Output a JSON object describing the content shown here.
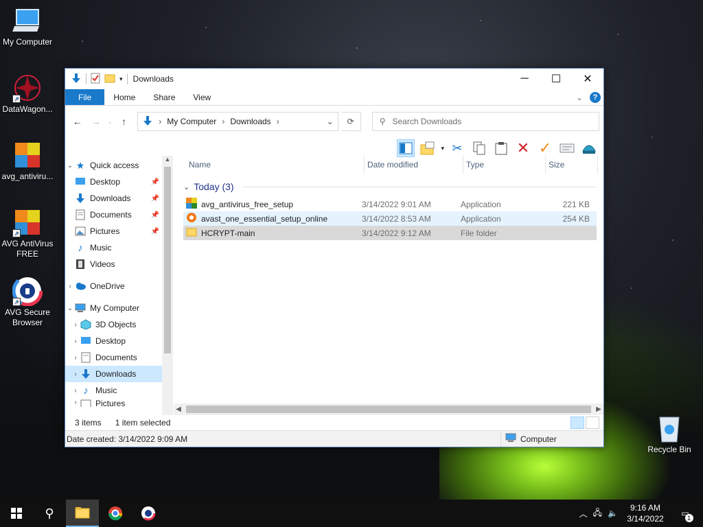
{
  "desktop": {
    "icons": [
      {
        "label": "My Computer",
        "icon": "computer-icon"
      },
      {
        "label": "DataWagon...",
        "icon": "datawagon-icon"
      },
      {
        "label": "avg_antiviru...",
        "icon": "avg-installer-icon"
      },
      {
        "label": "AVG AntiVirus FREE",
        "icon": "avg-antivirus-icon"
      },
      {
        "label": "AVG Secure Browser",
        "icon": "avg-browser-icon"
      },
      {
        "label": "Recycle Bin",
        "icon": "recycle-bin-icon"
      }
    ]
  },
  "window": {
    "title": "Downloads",
    "tabs": [
      "File",
      "Home",
      "Share",
      "View"
    ],
    "breadcrumb": [
      "My Computer",
      "Downloads"
    ],
    "search_placeholder": "Search Downloads",
    "columns": [
      "Name",
      "Date modified",
      "Type",
      "Size"
    ],
    "group_label": "Today (3)",
    "files": [
      {
        "name": "avg_antivirus_free_setup",
        "date": "3/14/2022 9:01 AM",
        "type": "Application",
        "size": "221 KB",
        "icon": "avg-setup-icon"
      },
      {
        "name": "avast_one_essential_setup_online",
        "date": "3/14/2022 8:53 AM",
        "type": "Application",
        "size": "254 KB",
        "icon": "avast-setup-icon"
      },
      {
        "name": "HCRYPT-main",
        "date": "3/14/2022 9:12 AM",
        "type": "File folder",
        "size": "",
        "icon": "folder-icon"
      }
    ],
    "nav": {
      "quick_access": "Quick access",
      "quick_items": [
        "Desktop",
        "Downloads",
        "Documents",
        "Pictures",
        "Music",
        "Videos"
      ],
      "onedrive": "OneDrive",
      "my_computer": "My Computer",
      "computer_items": [
        "3D Objects",
        "Desktop",
        "Documents",
        "Downloads",
        "Music",
        "Pictures"
      ]
    },
    "status": {
      "items": "3 items",
      "selected": "1 item selected",
      "date_created": "Date created: 3/14/2022 9:09 AM",
      "location": "Computer"
    }
  },
  "taskbar": {
    "time": "9:16 AM",
    "date": "3/14/2022",
    "notification_count": "1"
  },
  "colors": {
    "accent": "#1979ca",
    "selection": "#cce8ff",
    "taskbar": "#101010"
  }
}
